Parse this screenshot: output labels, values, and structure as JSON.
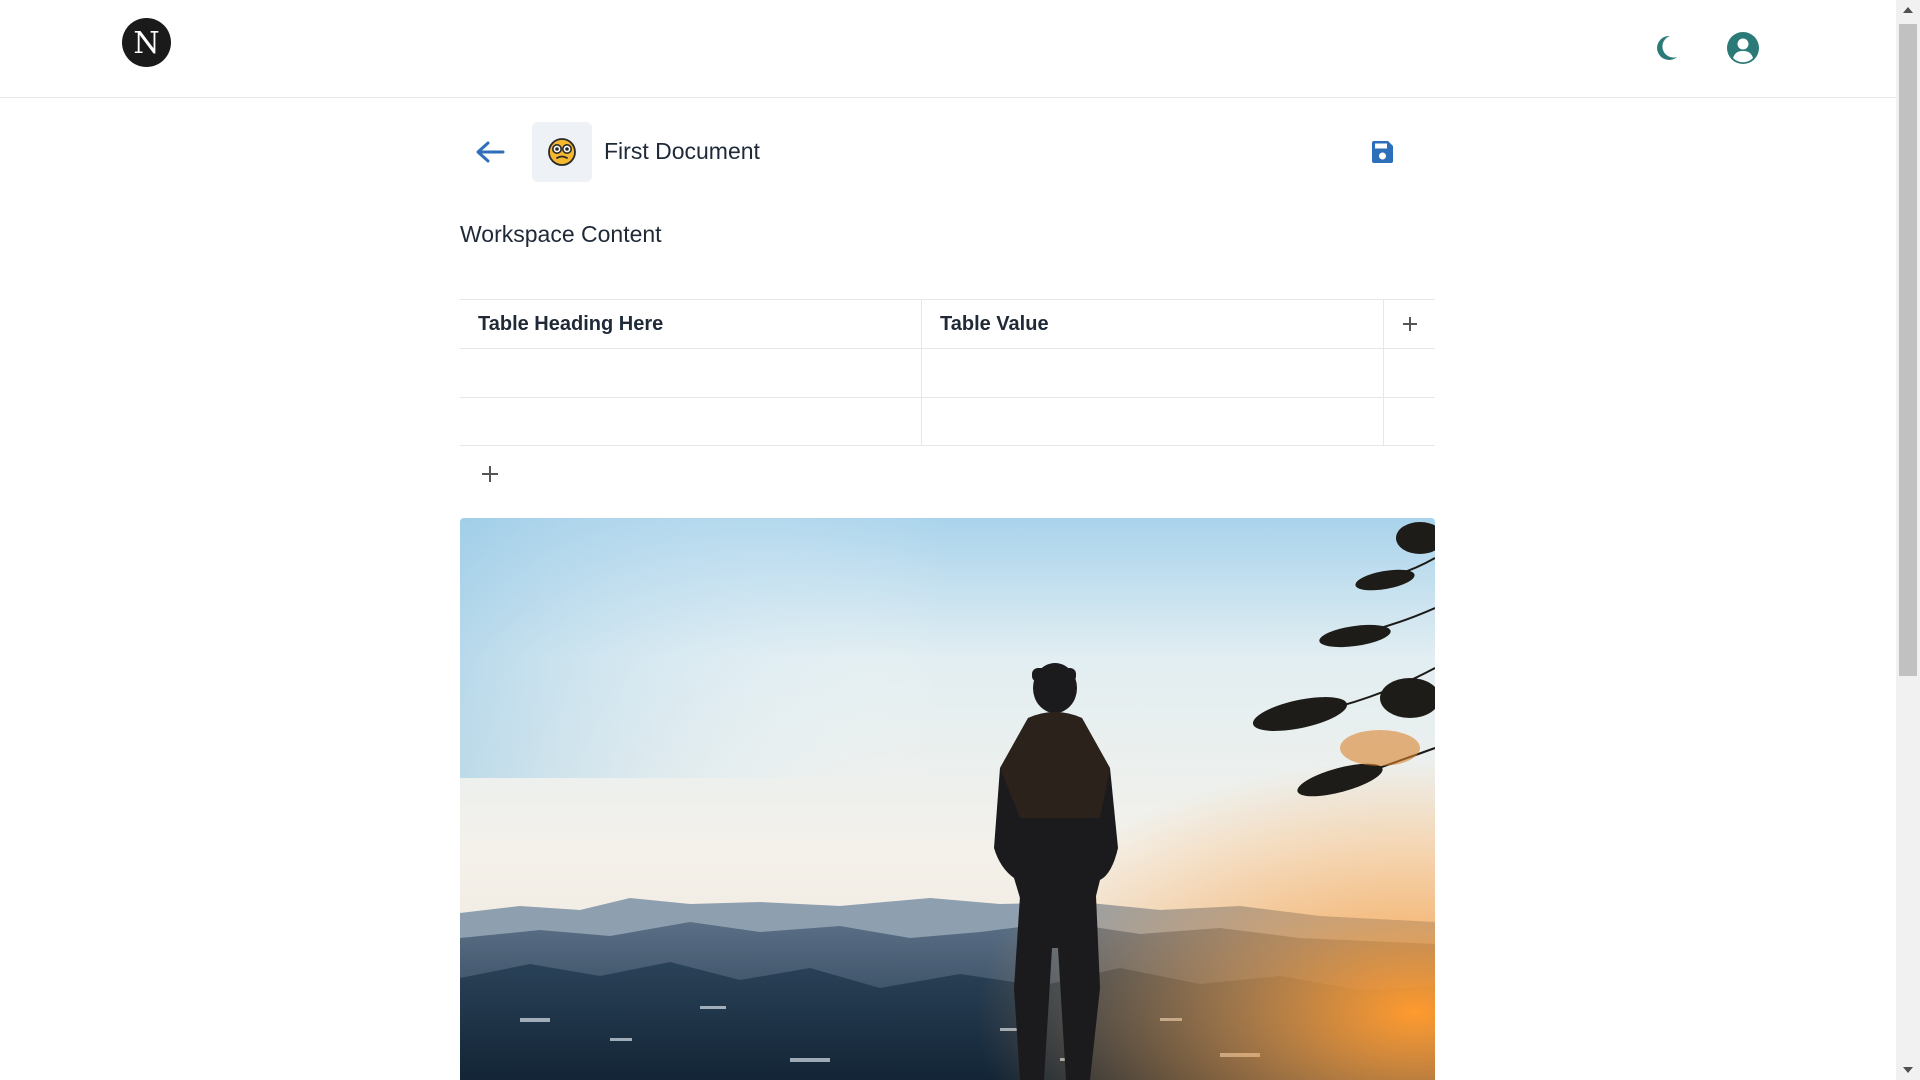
{
  "header": {
    "logo_letter": "N",
    "icons": {
      "logo": "n-logo-icon",
      "theme": "moon-icon",
      "profile": "user-circle-icon"
    }
  },
  "document": {
    "title": "First Document",
    "icon": "face-emoji-icon",
    "back_icon": "arrow-left-icon",
    "save_icon": "save-icon"
  },
  "content": {
    "section_title": "Workspace Content",
    "table": {
      "headers": [
        "Table Heading Here",
        "Table Value"
      ],
      "rows": [
        [
          "",
          ""
        ],
        [
          "",
          ""
        ]
      ]
    },
    "add_column_icon": "plus-icon",
    "add_row_icon": "plus-icon"
  },
  "image": {
    "subject": "mountain-landscape-photo"
  },
  "colors": {
    "accent_teal": "#2b7a78",
    "accent_blue": "#2d6fb8"
  }
}
